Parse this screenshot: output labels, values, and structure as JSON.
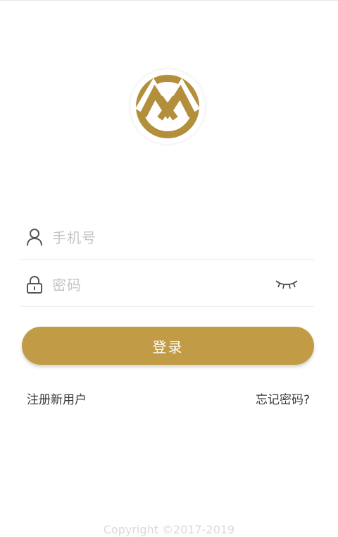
{
  "brand": {
    "logo_icon": "brand-logo-m-icon",
    "accent_color": "#c19b46"
  },
  "login_form": {
    "phone": {
      "icon": "user-icon",
      "placeholder": "手机号"
    },
    "password": {
      "icon": "lock-icon",
      "placeholder": "密码",
      "visibility_toggle_icon": "eye-closed-icon"
    },
    "submit_label": "登录"
  },
  "links": {
    "register_label": "注册新用户",
    "forgot_password_label": "忘记密码?"
  },
  "footer": {
    "copyright": "Copyright ©2017-2019"
  }
}
